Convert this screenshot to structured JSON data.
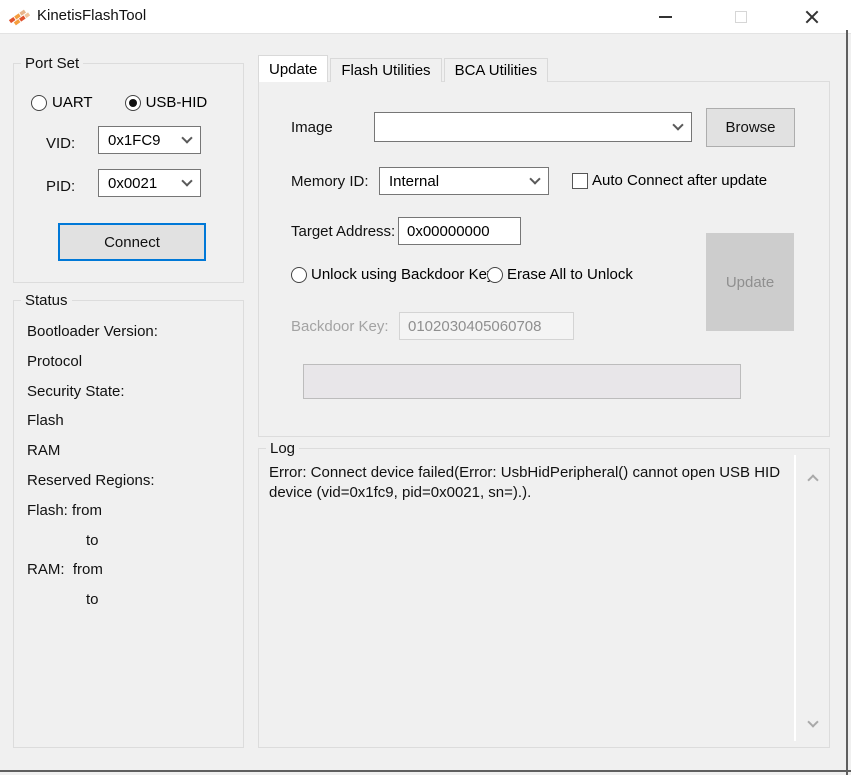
{
  "window": {
    "title": "KinetisFlashTool"
  },
  "port_set": {
    "legend": "Port Set",
    "uart_label": "UART",
    "usbhid_label": "USB-HID",
    "uart_selected": false,
    "usbhid_selected": true,
    "vid_label": "VID:",
    "vid_value": "0x1FC9",
    "pid_label": "PID:",
    "pid_value": "0x0021",
    "connect_label": "Connect"
  },
  "status": {
    "legend": "Status",
    "items": [
      "Bootloader Version:",
      "Protocol",
      "Security State:",
      "Flash",
      "RAM",
      "Reserved Regions:",
      "Flash: from",
      "to",
      "RAM:  from",
      "to"
    ]
  },
  "tabs": {
    "update": "Update",
    "flash_utilities": "Flash Utilities",
    "bca_utilities": "BCA Utilities"
  },
  "update_tab": {
    "image_label": "Image",
    "image_value": "",
    "browse_label": "Browse",
    "memory_id_label": "Memory ID:",
    "memory_id_value": "Internal",
    "auto_connect_label": "Auto Connect after update",
    "auto_connect_checked": false,
    "target_address_label": "Target Address:",
    "target_address_value": "0x00000000",
    "unlock_backdoor_label": "Unlock using Backdoor Key",
    "erase_all_label": "Erase All to Unlock",
    "update_button_label": "Update",
    "update_button_enabled": false,
    "backdoor_key_label": "Backdoor Key:",
    "backdoor_key_value": "0102030405060708",
    "progress_percent": 0
  },
  "log": {
    "legend": "Log",
    "text": "Error: Connect device failed(Error: UsbHidPeripheral() cannot open USB HID device (vid=0x1fc9, pid=0x0021, sn=).)."
  },
  "colors": {
    "window_bg": "#f0f0f0",
    "titlebar_bg": "#ffffff",
    "groupbox_border": "#dcdcdc",
    "focus_border": "#0078d7",
    "button_bg": "#e1e1e1",
    "disabled_button_bg": "#cdcdcd",
    "disabled_text": "#8f8f8f",
    "logo_orange": "#f59d3d",
    "logo_red": "#e0532f"
  }
}
